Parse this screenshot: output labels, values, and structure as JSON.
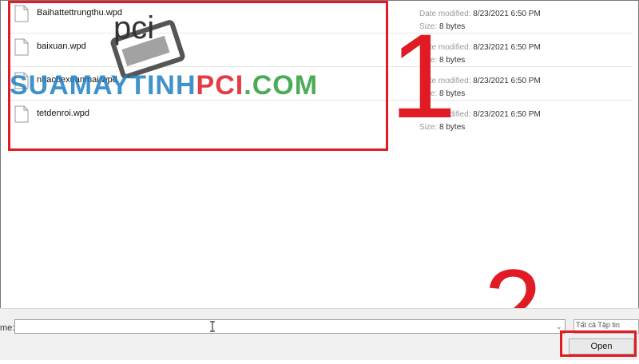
{
  "files": [
    {
      "name": "Baihattettrungthu.wpd",
      "date_label": "Date modified:",
      "date_value": "8/23/2021 6:50 PM",
      "size_label": "Size:",
      "size_value": "8 bytes"
    },
    {
      "name": "baixuan.wpd",
      "date_label": "Date modified:",
      "date_value": "8/23/2021 6:50 PM",
      "size_label": "Size:",
      "size_value": "8 bytes"
    },
    {
      "name": "nhacbexuanmai.wpd",
      "date_label": "Date modified:",
      "date_value": "8/23/2021 6:50 PM",
      "size_label": "Size:",
      "size_value": "8 bytes"
    },
    {
      "name": "tetdenroi.wpd",
      "date_label": "Date modified:",
      "date_value": "8/23/2021 6:50 PM",
      "size_label": "Size:",
      "size_value": "8 bytes"
    }
  ],
  "annotations": {
    "step1": "1",
    "step2": "2"
  },
  "watermark": {
    "brand_main": "SUAMAYTINH",
    "brand_accent": "PCI",
    "brand_dot": ".",
    "brand_tld": "COM",
    "logo_text": "pci"
  },
  "bottom": {
    "file_name_label": "me:",
    "file_name_value": "",
    "type_value": "Tất cả Tập tin",
    "open_label": "Open"
  },
  "colors": {
    "highlight": "#e01b24",
    "brand_blue": "#1f7fc2",
    "brand_green": "#2c9e3a"
  }
}
